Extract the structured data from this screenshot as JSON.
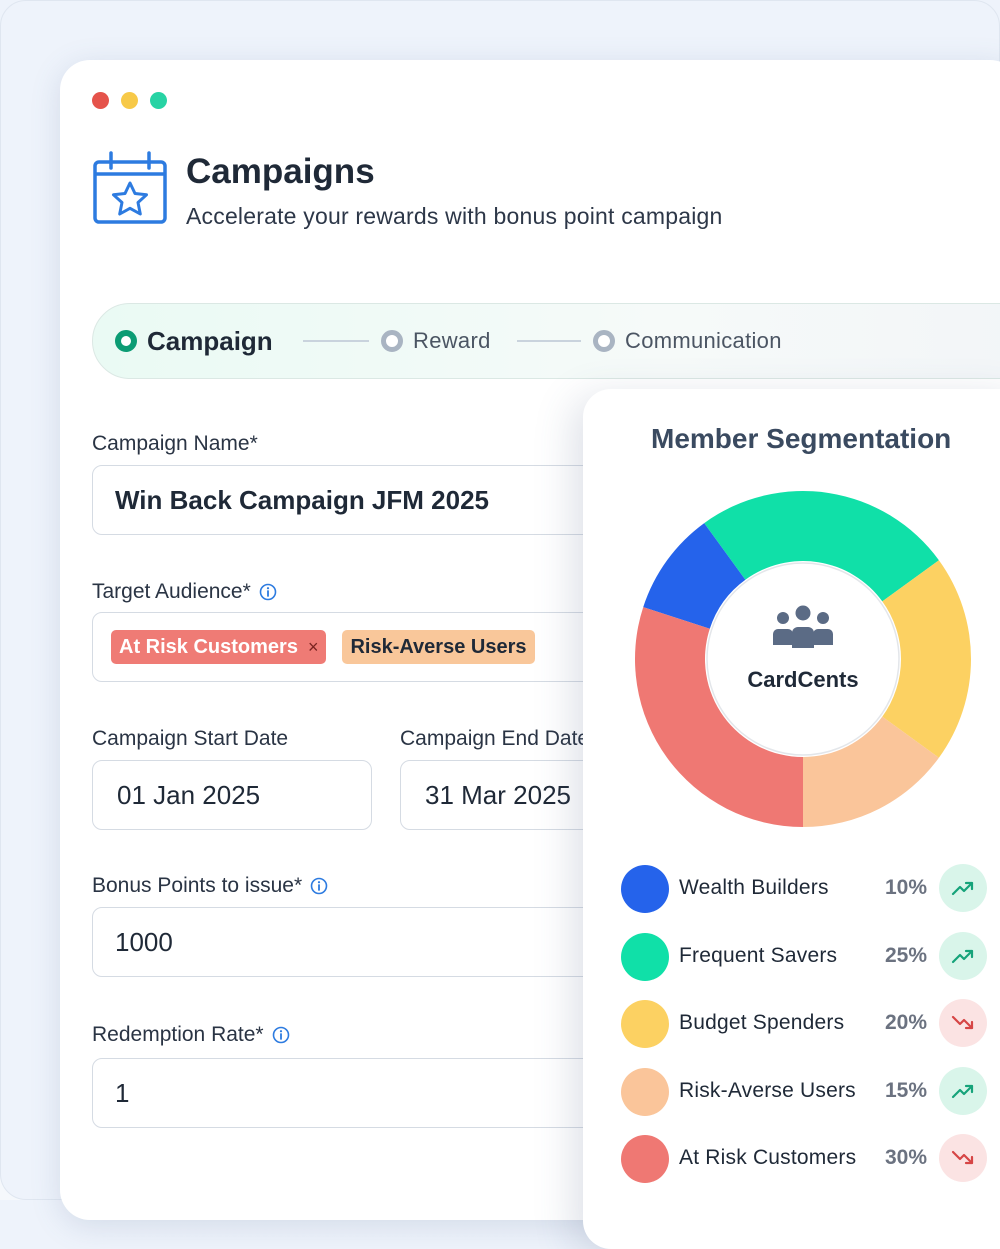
{
  "header": {
    "title": "Campaigns",
    "subtitle": "Accelerate your rewards with bonus point campaign",
    "icon": "calendar-star-icon"
  },
  "stepper": {
    "steps": [
      {
        "label": "Campaign",
        "state": "active"
      },
      {
        "label": "Reward",
        "state": "inactive"
      },
      {
        "label": "Communication",
        "state": "inactive"
      }
    ]
  },
  "form": {
    "campaign_name": {
      "label": "Campaign Name*",
      "value": "Win Back Campaign JFM 2025"
    },
    "target_audience": {
      "label": "Target Audience*",
      "chips": [
        {
          "label": "At Risk Customers",
          "remove": "×"
        },
        {
          "label": "Risk-Averse Users"
        }
      ]
    },
    "start_date": {
      "label": "Campaign Start Date",
      "value": "01 Jan 2025"
    },
    "end_date": {
      "label": "Campaign End Date",
      "value": "31 Mar 2025"
    },
    "bonus_points": {
      "label": "Bonus Points to issue*",
      "value": "1000"
    },
    "redemption_rate": {
      "label": "Redemption Rate*",
      "value": "1"
    }
  },
  "segmentation": {
    "title": "Member Segmentation",
    "center_label": "CardCents",
    "center_icon": "people-group-icon",
    "segments": [
      {
        "name": "Wealth Builders",
        "pct": "10%",
        "value": 10,
        "color": "#2563eb",
        "trend": "up"
      },
      {
        "name": "Frequent Savers",
        "pct": "25%",
        "value": 25,
        "color": "#10e0a8",
        "trend": "up"
      },
      {
        "name": "Budget Spenders",
        "pct": "20%",
        "value": 20,
        "color": "#fcd162",
        "trend": "down"
      },
      {
        "name": "Risk-Averse Users",
        "pct": "15%",
        "value": 15,
        "color": "#fac59a",
        "trend": "up"
      },
      {
        "name": "At Risk Customers",
        "pct": "30%",
        "value": 30,
        "color": "#ef7873",
        "trend": "down"
      }
    ]
  },
  "colors": {
    "accent": "#0c9c74",
    "trend_up": "#16a37a",
    "trend_down": "#d64545"
  }
}
